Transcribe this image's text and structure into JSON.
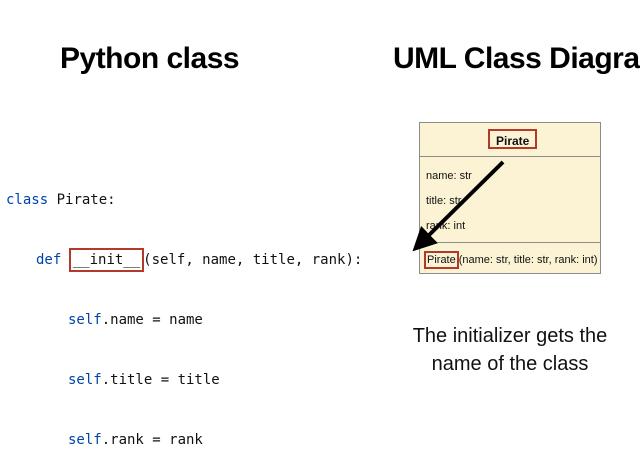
{
  "headings": {
    "left": "Python class",
    "right": "UML Class Diagram"
  },
  "code": {
    "line1": {
      "kw": "class",
      "rest": " Pirate:"
    },
    "line2": {
      "kw": "def",
      "highlight": "__init__",
      "rest": "(self, name, title, rank):"
    },
    "line3": {
      "self": "self",
      "rest": ".name = name"
    },
    "line4": {
      "self": "self",
      "rest": ".title = title"
    },
    "line5": {
      "self": "self",
      "rest": ".rank = rank"
    }
  },
  "uml": {
    "class_name": "Pirate",
    "attributes": [
      "name: str",
      "title: str",
      "rank: int"
    ],
    "method": {
      "name": "Pirate",
      "params": "(name: str, title: str, rank: int)"
    }
  },
  "caption": {
    "line1": "The initializer gets the",
    "line2": "name of the class"
  },
  "colors": {
    "highlight_border": "#b23a2a",
    "uml_fill": "#fbf3d3",
    "keyword": "#0044aa",
    "arrow": "#000000"
  }
}
